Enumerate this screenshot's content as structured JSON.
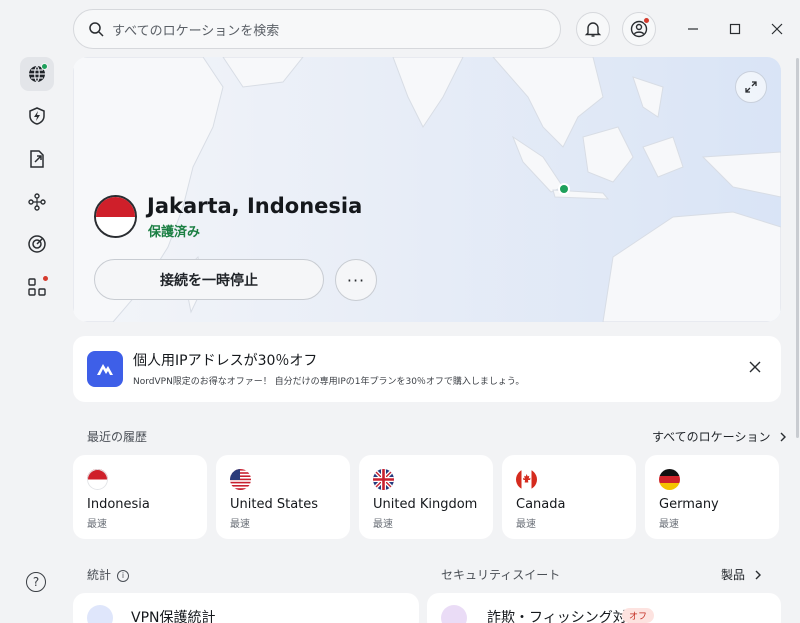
{
  "search": {
    "placeholder": "すべてのロケーションを検索"
  },
  "connection": {
    "location": "Jakarta, Indonesia",
    "status": "保護済み",
    "pause_label": "接続を一時停止",
    "more_label": "···"
  },
  "promo": {
    "title": "個人用IPアドレスが30％オフ",
    "description": "NordVPN限定のお得なオファー！ 自分だけの専用IPの1年プランを30％オフで購入しましょう。"
  },
  "recents": {
    "label": "最近の履歴",
    "all_link": "すべてのロケーション",
    "items": [
      {
        "name": "Indonesia",
        "sub": "最速"
      },
      {
        "name": "United States",
        "sub": "最速"
      },
      {
        "name": "United Kingdom",
        "sub": "最速"
      },
      {
        "name": "Canada",
        "sub": "最速"
      },
      {
        "name": "Germany",
        "sub": "最速"
      }
    ]
  },
  "bottom": {
    "stats_label": "統計",
    "info_glyph": "i",
    "suite_label": "セキュリティスイート",
    "products_link": "製品",
    "vpn_card_text": "VPN保護統計",
    "phishing_card_text": "詐欺・フィッシング対策",
    "off_badge": "オフ"
  },
  "help_glyph": "?",
  "colors": {
    "accent_green": "#1ea05b",
    "notification_red": "#d53b2e",
    "brand_blue": "#3e5fe8"
  }
}
